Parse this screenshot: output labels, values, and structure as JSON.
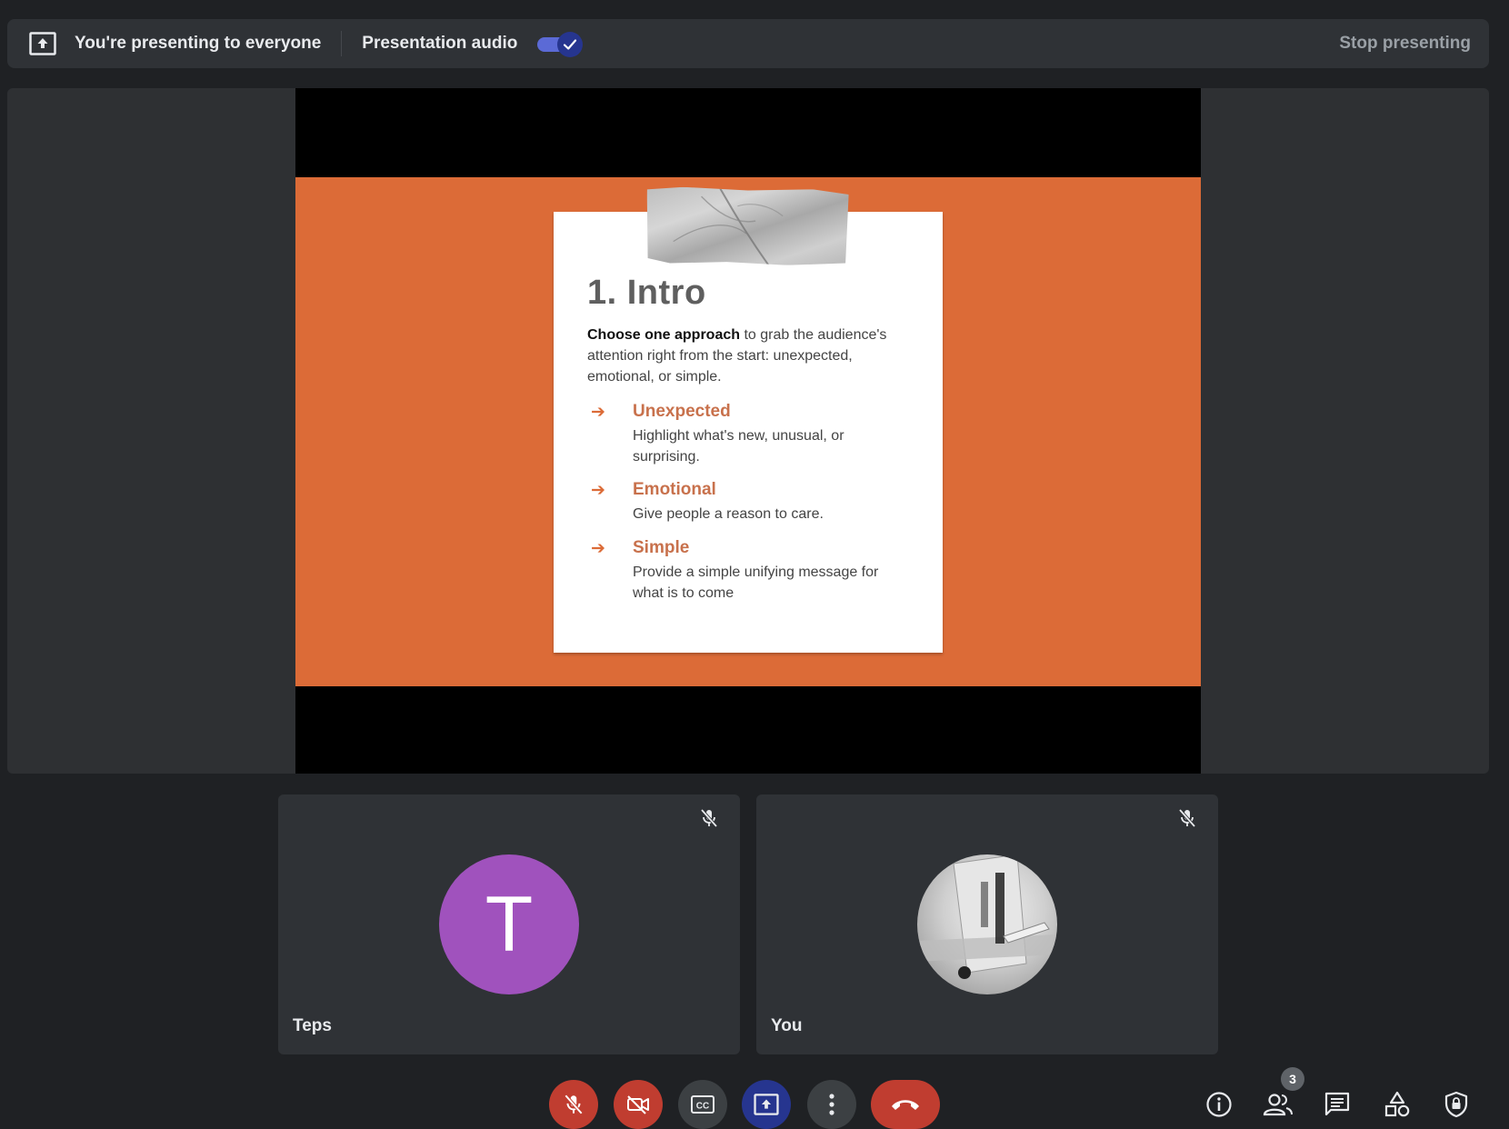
{
  "topbar": {
    "presenting_message": "You're presenting to everyone",
    "audio_label": "Presentation audio",
    "audio_enabled": true,
    "stop_label": "Stop presenting"
  },
  "slide": {
    "title": "1. Intro",
    "intro_bold": "Choose one approach",
    "intro_rest": " to grab the audience's attention right from the start: unexpected, emotional, or simple.",
    "points": [
      {
        "title": "Unexpected",
        "desc": "Highlight what's new, unusual, or surprising."
      },
      {
        "title": "Emotional",
        "desc": "Give people a reason to care."
      },
      {
        "title": "Simple",
        "desc": "Provide a simple unifying message for what is to come"
      }
    ],
    "background_color": "#dc6b37"
  },
  "participants": [
    {
      "name": "Teps",
      "initial": "T",
      "avatar_color": "#a052bd",
      "muted": true
    },
    {
      "name": "You",
      "avatar": "airplane-photo",
      "muted": true
    }
  ],
  "controls": {
    "participant_count": "3"
  }
}
